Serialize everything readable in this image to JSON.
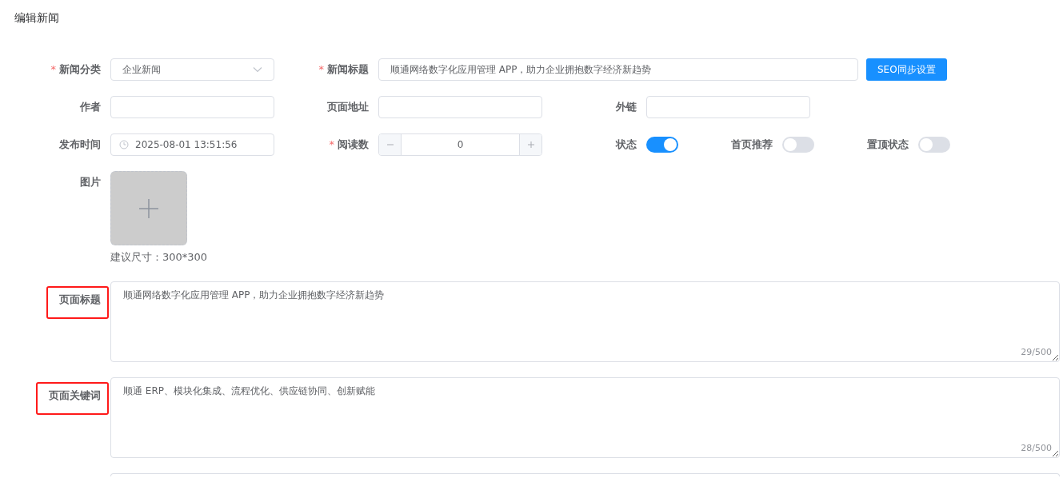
{
  "title": "编辑新闻",
  "rows": [
    [
      {
        "kind": "select",
        "label": "新闻分类",
        "required_mark": "*",
        "value": "企业新闻"
      },
      {
        "kind": "wide_text",
        "label": "新闻标题",
        "required_mark": "*",
        "value": "顺通网络数字化应用管理 APP，助力企业拥抱数字经济新趋势"
      },
      {
        "kind": "button",
        "label": "SEO同步设置"
      }
    ],
    [
      {
        "kind": "text",
        "label": "作者"
      },
      {
        "kind": "text",
        "label": "页面地址"
      },
      {
        "kind": "text",
        "label": "外链"
      }
    ],
    [
      {
        "kind": "date",
        "label": "发布时间",
        "value": "2025-08-01 13:51:56"
      },
      {
        "kind": "number",
        "label": "阅读数",
        "required_mark": "*",
        "value": "0"
      },
      {
        "kind": "switch",
        "label": "状态",
        "on": true
      },
      {
        "kind": "switch",
        "label": "首页推荐",
        "on": false
      },
      {
        "kind": "switch",
        "label": "置顶状态",
        "on": false
      }
    ]
  ],
  "upload": {
    "label": "图片",
    "hint": "建议尺寸：300*300"
  },
  "textareas": [
    {
      "label": "页面标题",
      "value": "顺通网络数字化应用管理 APP，助力企业拥抱数字经济新趋势",
      "count": "29/500",
      "highlighted": true
    },
    {
      "label": "页面关键词",
      "value": "顺通 ERP、模块化集成、流程优化、供应链协同、创新赋能",
      "count": "28/500",
      "highlighted": true
    }
  ]
}
